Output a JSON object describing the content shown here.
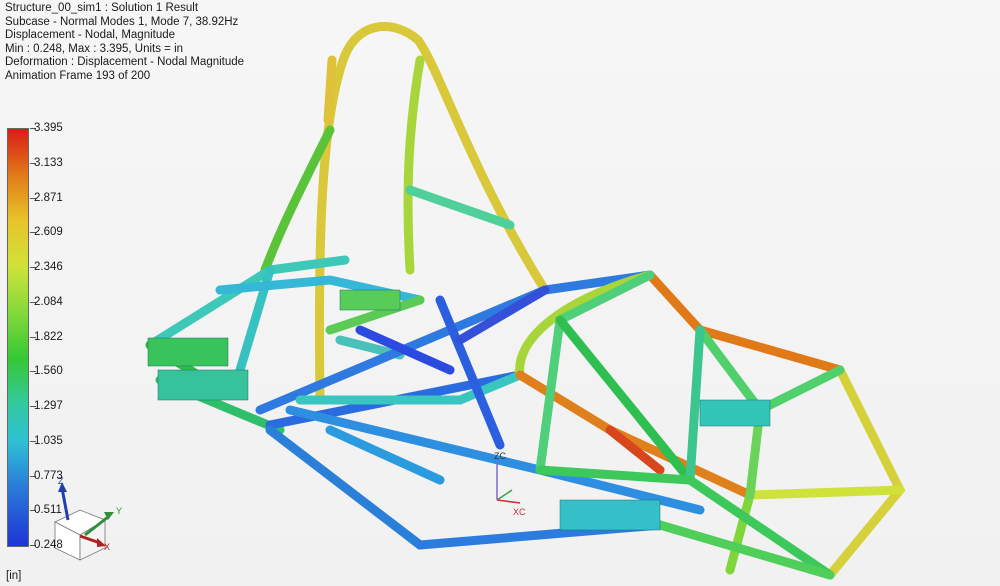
{
  "header": {
    "line1": "Structure_00_sim1 : Solution 1 Result",
    "line2": "Subcase - Normal Modes 1, Mode 7, 38.92Hz",
    "line3": "Displacement - Nodal, Magnitude",
    "line4": "Min : 0.248, Max : 3.395, Units = in",
    "line5": "Deformation : Displacement - Nodal Magnitude",
    "line6": "Animation Frame 193 of 200"
  },
  "legend": {
    "labels": [
      "3.395",
      "3.133",
      "2.871",
      "2.609",
      "2.346",
      "2.084",
      "1.822",
      "1.560",
      "1.297",
      "1.035",
      "0.773",
      "0.511",
      "0.248"
    ],
    "colors": {
      "max": "#d91c18",
      "high": "#e8c42a",
      "mid": "#36c834",
      "low": "#2fc0d6",
      "min": "#1d34d6"
    }
  },
  "units_label": "[in]",
  "triad": {
    "z": "Z",
    "y": "Y",
    "x": "X"
  },
  "work_triad": {
    "zc": "ZC",
    "xc": "XC"
  },
  "icons": [
    "coordinate-triad-icon",
    "work-coordinate-triad-icon"
  ]
}
